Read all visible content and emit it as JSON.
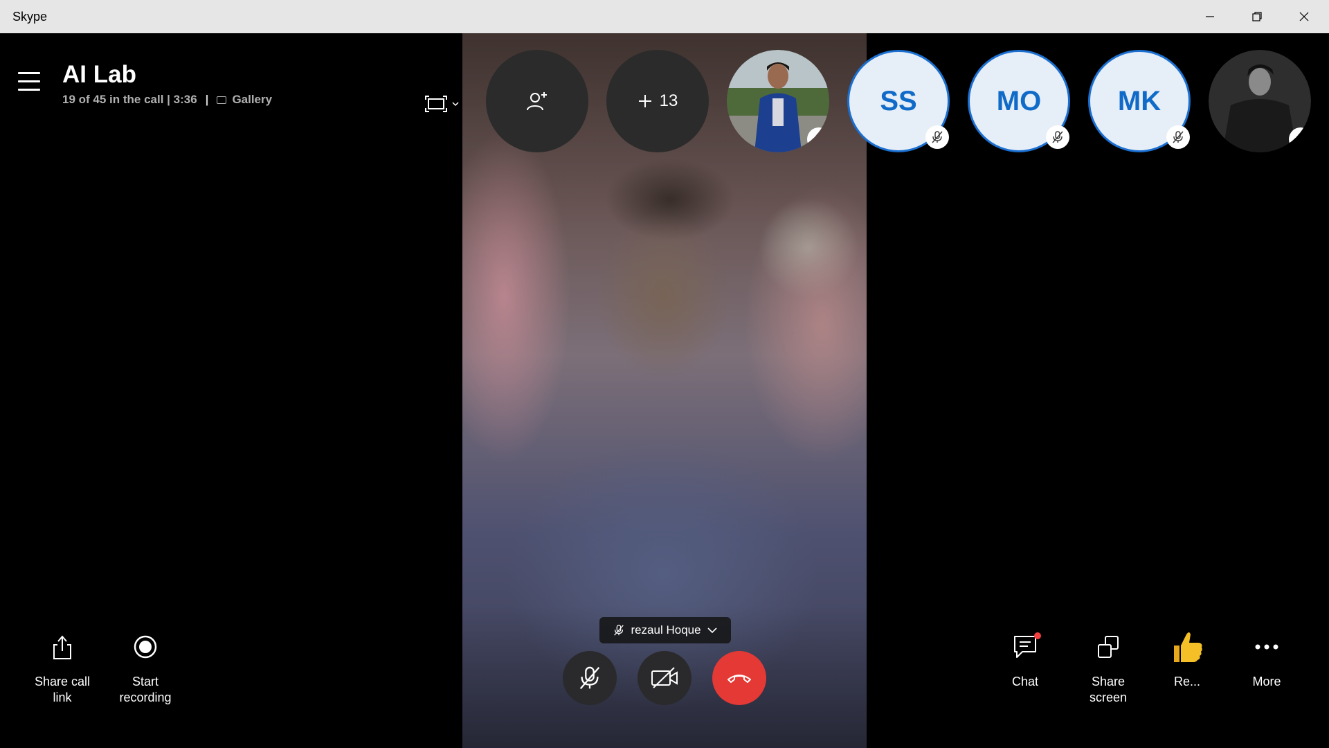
{
  "window": {
    "title": "Skype",
    "controls": [
      "minimize-icon",
      "restore-icon",
      "close-icon"
    ]
  },
  "call": {
    "title": "AI Lab",
    "status": "19 of 45 in the call | 3:36",
    "separator": "|",
    "view_label": "Gallery"
  },
  "participants": {
    "add_icon": "add-person-icon",
    "more_count": "13",
    "initials": [
      {
        "initials": "SS"
      },
      {
        "initials": "MO"
      },
      {
        "initials": "MK"
      }
    ]
  },
  "speaker": {
    "name": "rezaul Hoque"
  },
  "controls": {
    "mute_icon": "mic-off-icon",
    "video_icon": "video-off-icon",
    "end_icon": "hang-up-icon"
  },
  "actions_left": [
    {
      "label": "Share call\nlink",
      "icon": "share-icon"
    },
    {
      "label": "Start\nrecording",
      "icon": "record-icon"
    }
  ],
  "actions_right": [
    {
      "label": "Chat",
      "icon": "chat-icon"
    },
    {
      "label": "Share\nscreen",
      "icon": "share-screen-icon"
    },
    {
      "label": "Re...",
      "icon": "thumbs-up-icon"
    },
    {
      "label": "More",
      "icon": "more-icon"
    }
  ],
  "colors": {
    "initials_accent": "#0f6ac8",
    "end_call": "#e53935",
    "notification_dot": "#f04040"
  }
}
